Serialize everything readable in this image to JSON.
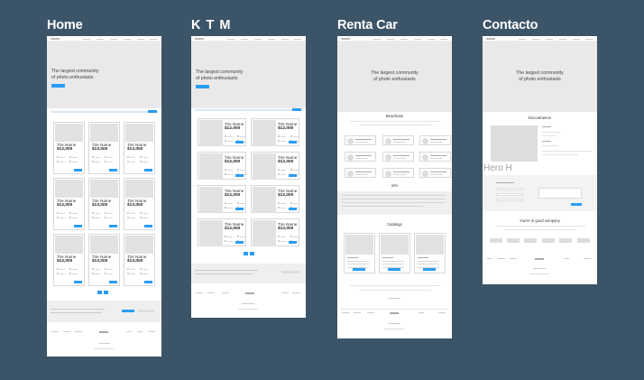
{
  "titles": {
    "home": "Home",
    "ktm": "K T M",
    "renta": "Renta Car",
    "contacto": "Contacto"
  },
  "hero": {
    "line1": "The largest community",
    "line2": "of photo enthusiasts"
  },
  "card": {
    "name": "Tire Name",
    "price": "$12,000",
    "price_b": "$13,000"
  },
  "renta": {
    "section1": "Beneficios",
    "section2": "info",
    "section3": "Catalogo"
  },
  "contacto": {
    "section1": "Encontramos",
    "section2": "You're in good company"
  },
  "overlay": {
    "hero_label": "Hero H"
  },
  "colors": {
    "background": "#3c5468",
    "accent": "#2a9df4",
    "frame": "#ffffff",
    "placeholder": "#e9e9e9"
  }
}
